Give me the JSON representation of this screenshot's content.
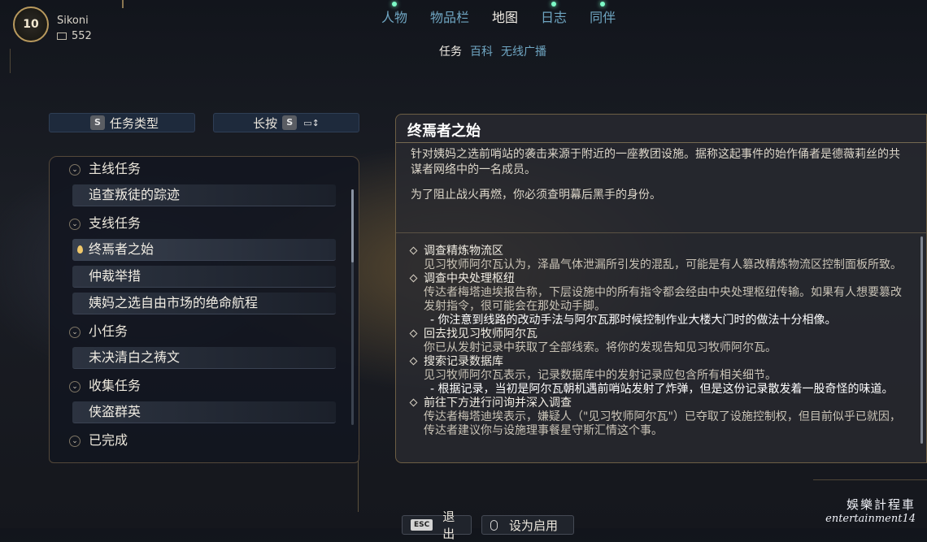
{
  "player": {
    "level": "10",
    "name": "Sikoni",
    "currency": "552"
  },
  "tabs": [
    {
      "label": "人物",
      "notify": true
    },
    {
      "label": "物品栏",
      "notify": false
    },
    {
      "label": "地图",
      "notify": false
    },
    {
      "label": "日志",
      "notify": true
    },
    {
      "label": "同伴",
      "notify": true
    }
  ],
  "subtabs": [
    "任务",
    "百科",
    "无线广播"
  ],
  "filters": {
    "type_key": "S",
    "type_label": "任务类型",
    "hold_label": "长按",
    "hold_key": "S"
  },
  "quest_list": {
    "main": {
      "label": "主线任务",
      "quests": [
        "追查叛徒的踪迹"
      ]
    },
    "side": {
      "label": "支线任务",
      "quests": [
        "终焉者之始",
        "仲裁举措",
        "姨妈之选自由市场的绝命航程"
      ]
    },
    "minor": {
      "label": "小任务",
      "quests": [
        "未决清白之祷文"
      ]
    },
    "collect": {
      "label": "收集任务",
      "quests": [
        "侠盗群英"
      ]
    },
    "done": {
      "label": "已完成"
    }
  },
  "detail": {
    "title": "终焉者之始",
    "desc1": "针对姨妈之选前哨站的袭击来源于附近的一座教团设施。据称这起事件的始作俑者是德薇莉丝的共谋者网络中的一名成员。",
    "desc2": "为了阻止战火再燃，你必须查明幕后黑手的身份。",
    "objectives": [
      {
        "title": "调查精炼物流区",
        "text": "见习牧师阿尔瓦认为，泽晶气体泄漏所引发的混乱，可能是有人篡改精炼物流区控制面板所致。",
        "note": ""
      },
      {
        "title": "调查中央处理枢纽",
        "text": "传达者梅塔迪埃报告称，下层设施中的所有指令都会经由中央处理枢纽传输。如果有人想要篡改发射指令，很可能会在那处动手脚。",
        "note": "- 你注意到线路的改动手法与阿尔瓦那时候控制作业大楼大门时的做法十分相像。"
      },
      {
        "title": "回去找见习牧师阿尔瓦",
        "text": "你已从发射记录中获取了全部线索。将你的发现告知见习牧师阿尔瓦。",
        "note": ""
      },
      {
        "title": "搜索记录数据库",
        "text": "见习牧师阿尔瓦表示，记录数据库中的发射记录应包含所有相关细节。",
        "note": "- 根据记录，当初是阿尔瓦朝机遇前哨站发射了炸弹，但是这份记录散发着一股奇怪的味道。"
      },
      {
        "title": "前往下方进行问询并深入调查",
        "text": "传达者梅塔迪埃表示，嫌疑人（\"见习牧师阿尔瓦\"）已夺取了设施控制权，但目前似乎已就因，传达者建议你与设施理事餐星守斯汇情这个事。",
        "note": ""
      }
    ]
  },
  "bottom": {
    "esc_key": "ESC",
    "back_label": "退出",
    "set_label": "设为启用"
  },
  "watermark": {
    "line1": "娛樂計程車",
    "line2": "entertainment14"
  },
  "colors": {
    "accent_gold": "#b99a5e",
    "tab_inactive": "#6fa6c2",
    "notify_dot": "#7dffc8"
  }
}
